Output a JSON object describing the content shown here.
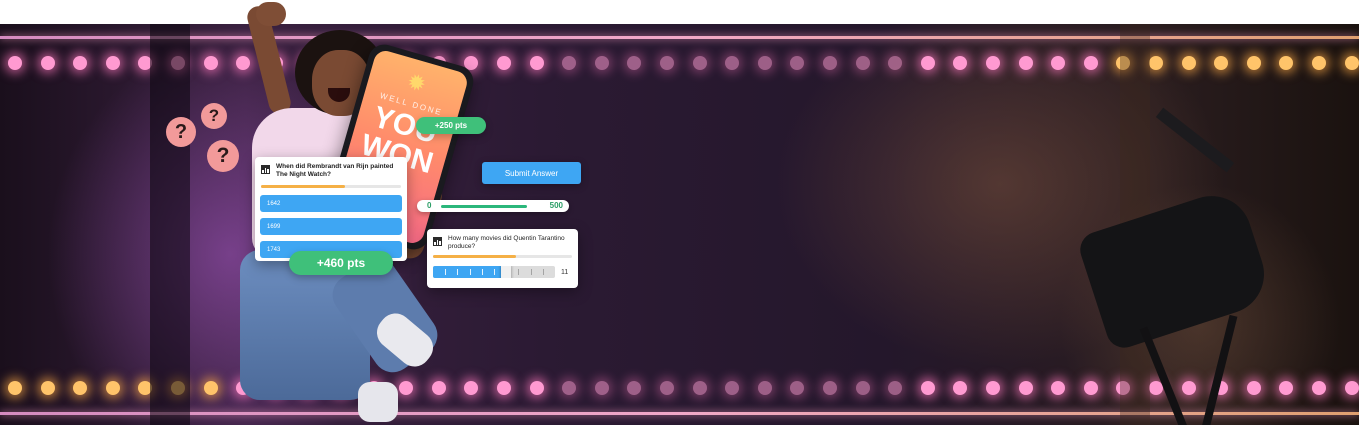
{
  "phone": {
    "small_text": "WELL DONE",
    "big_line1": "YOU",
    "big_line2": "WON"
  },
  "badges": {
    "small": "+250 pts",
    "large": "+460 pts"
  },
  "quiz_card": {
    "question": "When did Rembrandt van Rijn painted The Night Watch?",
    "progress": 0.6,
    "answers": [
      "1642",
      "1699",
      "1743"
    ]
  },
  "submit_button": {
    "label": "Submit Answer"
  },
  "range": {
    "min": "0",
    "max": "500"
  },
  "slider_card": {
    "question": "How many movies did Quentin Tarantino produce?",
    "progress": 0.6,
    "slider_value": "11",
    "slider_fraction": 0.6
  },
  "icons": {
    "question_mark": "question-bubble-icon",
    "chart": "chart-icon",
    "party": "party-popper-icon"
  },
  "colors": {
    "accent_blue": "#3ea6f3",
    "points_green": "#3fc07a",
    "progress_orange": "#f5b046"
  }
}
